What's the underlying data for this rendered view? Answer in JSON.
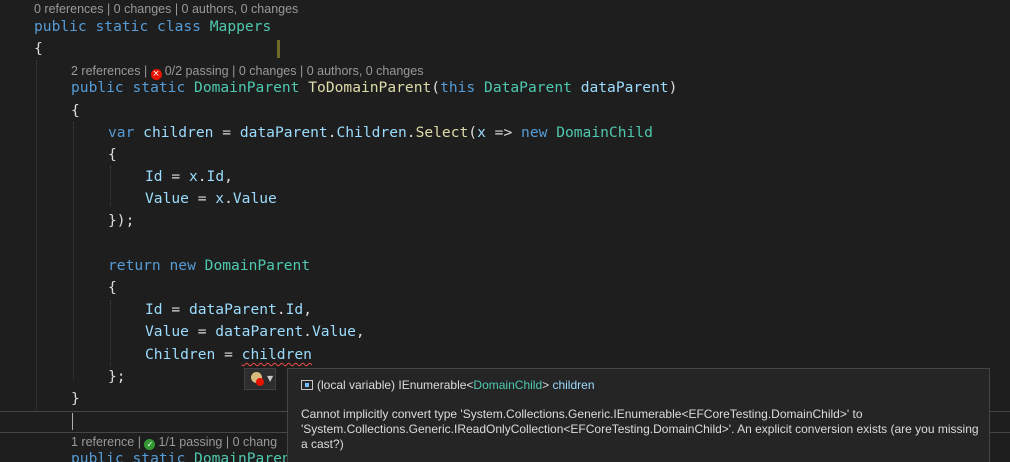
{
  "lenses": {
    "class_lens": "0 references | 0 changes | 0 authors, 0 changes",
    "method1_refs": "2 references | ",
    "method1_status": "0/2 passing",
    "method1_rest": " | 0 changes | 0 authors, 0 changes",
    "method2_refs": "1 reference | ",
    "method2_status": "1/1 passing",
    "method2_rest": " | 0 chang"
  },
  "code": {
    "public": "public",
    "static": "static",
    "class": "class",
    "class_name": "Mappers",
    "open_brace": "{",
    "close_brace": "}",
    "domain_parent": "DomainParent",
    "method_name": "ToDomainParent",
    "this": "this",
    "data_parent_type": "DataParent",
    "data_parent_param": "dataParent",
    "var": "var",
    "children_var": "children",
    "children_prop": "Children",
    "select": "Select",
    "x": "x",
    "new": "new",
    "domain_child": "DomainChild",
    "id": "Id",
    "value": "Value",
    "return": "return",
    "close_paren_semi": "});",
    "close_brace_semi": "};",
    "next_method_partial": "DomainParen"
  },
  "tooltip": {
    "prefix": "(local variable) IEnumerable<",
    "type": "DomainChild",
    "suffix": "> ",
    "variable": "children",
    "error_message": "Cannot implicitly convert type 'System.Collections.Generic.IEnumerable<EFCoreTesting.DomainChild>' to 'System.Collections.Generic.IReadOnlyCollection<EFCoreTesting.DomainChild>'. An explicit conversion exists (are you missing a cast?)"
  },
  "icons": {
    "fail": "error-circle-icon",
    "pass": "check-circle-icon",
    "quick_action": "lightbulb-error-icon",
    "symbol": "local-variable-icon"
  },
  "colors": {
    "background": "#1e1e1e",
    "keyword": "#569cd6",
    "type": "#4ec9b0",
    "method": "#dcdcaa",
    "variable": "#9cdcfe",
    "error": "#f14c4c"
  }
}
